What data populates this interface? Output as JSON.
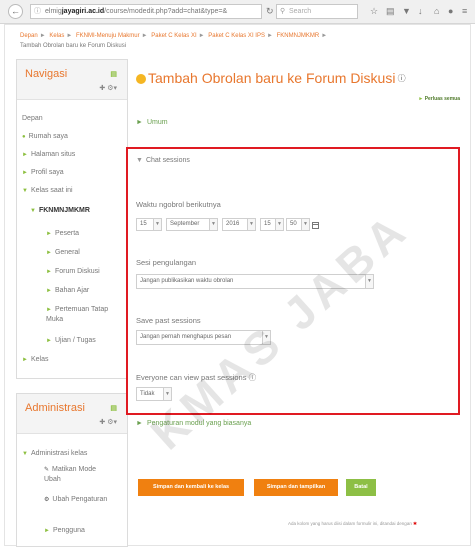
{
  "browser": {
    "back_icon": "back-arrow-icon",
    "url_prefix": "elmig",
    "url_domain": "jayagiri.ac.id",
    "url_path": "/course/modedit.php?add=chat&type=&",
    "search_placeholder": "Search",
    "icons": [
      "bookmark-star-icon",
      "reading-list-icon",
      "pocket-icon",
      "download-icon",
      "home-icon",
      "chat-icon",
      "menu-icon"
    ]
  },
  "breadcrumb": {
    "items": [
      "Depan",
      "Kelas",
      "FKNMI-Menuju Makmur",
      "Paket C Kelas XI",
      "Paket C Kelas XI IPS",
      "FKNMNJMKMR"
    ],
    "current": "Tambah Obrolan baru ke Forum Diskusi"
  },
  "navigation": {
    "title": "Navigasi",
    "items": [
      {
        "label": "Depan"
      },
      {
        "label": "Rumah saya"
      },
      {
        "label": "Halaman situs"
      },
      {
        "label": "Profil saya"
      },
      {
        "label": "Kelas saat ini"
      },
      {
        "label": "FKNMNJMKMR"
      },
      {
        "label": "Peserta"
      },
      {
        "label": "General"
      },
      {
        "label": "Forum Diskusi"
      },
      {
        "label": "Bahan Ajar"
      },
      {
        "label": "Pertemuan Tatap Muka"
      },
      {
        "label": "Ujian / Tugas"
      },
      {
        "label": "Kelas"
      }
    ]
  },
  "administration": {
    "title": "Administrasi",
    "items": [
      {
        "label": "Administrasi kelas"
      },
      {
        "label": "Matikan Mode Ubah"
      },
      {
        "label": "Ubah Pengaturan"
      },
      {
        "label": "Pengguna"
      }
    ]
  },
  "main": {
    "title": "Tambah Obrolan baru ke Forum Diskusi",
    "expand_all": "Perluas semua",
    "section_umum": "Umum",
    "section_chat": "Chat sessions",
    "waktu_label": "Waktu ngobrol berikutnya",
    "date": {
      "day": "15",
      "month": "September",
      "year": "2016",
      "hour": "15",
      "minute": "50"
    },
    "repeat_label": "Sesi pengulangan",
    "repeat_value": "Jangan publikasikan waktu obrolan",
    "save_label": "Save past sessions",
    "save_value": "Jangan pernah menghapus pesan",
    "view_label": "Everyone can view past sessions",
    "view_value": "Tidak",
    "section_modul": "Pengaturan modul yang biasanya",
    "buttons": {
      "save_return": "Simpan dan kembali ke kelas",
      "save_display": "Simpan dan tampilkan",
      "cancel": "Batal"
    },
    "required_note": "Ada kolom yang harus diisi dalam formulir ini, ditandai dengan"
  },
  "watermark": "KMAS JABA",
  "colors": {
    "accent": "#e8772e",
    "green": "#8dbf45",
    "highlight": "#e01a22",
    "button_orange": "#f08010"
  }
}
